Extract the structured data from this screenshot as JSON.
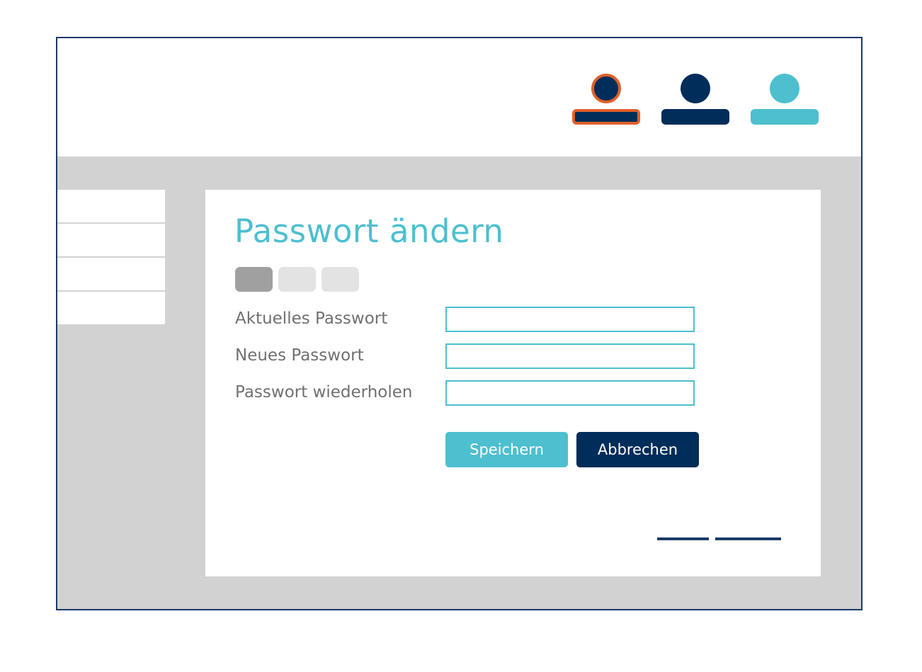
{
  "users": [
    {
      "name": "user-1",
      "state": "selected",
      "color": "#002d5a",
      "highlight_color": "#e0602a"
    },
    {
      "name": "user-2",
      "state": "default",
      "color": "#002d5a"
    },
    {
      "name": "user-3",
      "state": "default",
      "color": "#4dbfcf"
    }
  ],
  "dialog": {
    "title": "Passwort ändern",
    "steps": {
      "count": 3,
      "active_index": 0
    },
    "fields": [
      {
        "label": "Aktuelles Passwort",
        "value": "",
        "placeholder": ""
      },
      {
        "label": "Neues Passwort",
        "value": "",
        "placeholder": ""
      },
      {
        "label": "Passwort wiederholen",
        "value": "",
        "placeholder": ""
      }
    ],
    "save_label": "Speichern",
    "cancel_label": "Abbrechen"
  },
  "colors": {
    "accent": "#4dbfcf",
    "primary": "#002d5a",
    "highlight": "#e0602a",
    "background": "#d2d2d2",
    "label_text": "#707070"
  }
}
